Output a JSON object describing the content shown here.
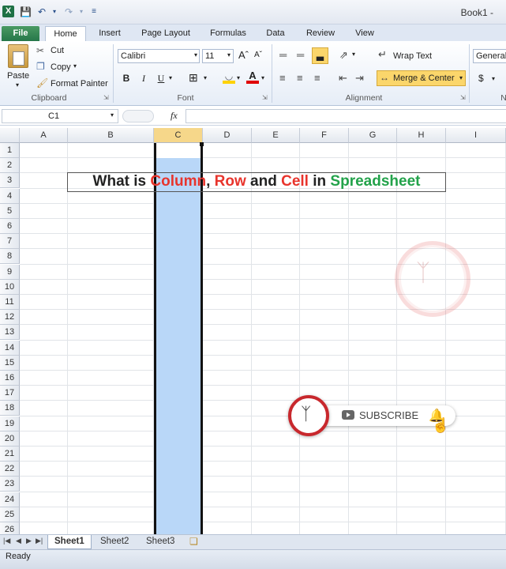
{
  "window": {
    "title": "Book1 -"
  },
  "app_icon": "excel-icon",
  "tabs": [
    "File",
    "Home",
    "Insert",
    "Page Layout",
    "Formulas",
    "Data",
    "Review",
    "View"
  ],
  "clipboard": {
    "paste": "Paste",
    "cut": "Cut",
    "copy": "Copy",
    "format_painter": "Format Painter",
    "label": "Clipboard"
  },
  "font": {
    "name": "Calibri",
    "size": "11",
    "label": "Font",
    "bold": "B",
    "italic": "I",
    "underline": "U"
  },
  "alignment": {
    "wrap_text": "Wrap Text",
    "merge_center": "Merge & Center",
    "label": "Alignment"
  },
  "number": {
    "format": "General",
    "currency": "$",
    "label_partial": "N"
  },
  "formula_bar": {
    "name_box": "C1",
    "fx": "fx",
    "content": ""
  },
  "columns": [
    "A",
    "B",
    "C",
    "D",
    "E",
    "F",
    "G",
    "H",
    "I"
  ],
  "rows": [
    "1",
    "2",
    "3",
    "4",
    "5",
    "6",
    "7",
    "8",
    "9",
    "10",
    "11",
    "12",
    "13",
    "14",
    "15",
    "16",
    "17",
    "18",
    "19",
    "20",
    "21",
    "22",
    "23",
    "24",
    "25",
    "26"
  ],
  "selected_column": "C",
  "cell_text": {
    "p1": "What is ",
    "p2": "Column",
    "p3": ", ",
    "p4": "Row",
    "p5": " and ",
    "p6": "Cell",
    "p7": " in ",
    "p8": "Spreadsheet"
  },
  "colors": {
    "column": "#e8342c",
    "row": "#e8342c",
    "cell": "#e8342c",
    "spreadsheet": "#22a24a",
    "selection": "#b9d7f8",
    "accent": "#1e7145"
  },
  "overlay": {
    "subscribe": "SUBSCRIBE"
  },
  "sheets": [
    "Sheet1",
    "Sheet2",
    "Sheet3"
  ],
  "status": "Ready"
}
